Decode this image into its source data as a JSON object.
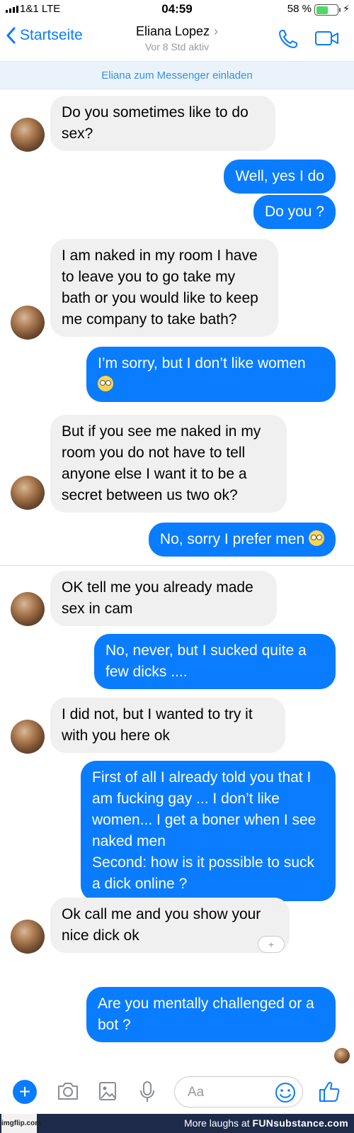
{
  "status_bar": {
    "carrier": "1&1  LTE",
    "time": "04:59",
    "battery": "58 %",
    "battery_level": 0.58,
    "charging_icon": "bolt-icon"
  },
  "header": {
    "back_label": "Startseite",
    "contact_name": "Eliana Lopez",
    "contact_status": "Vor 8 Std aktiv",
    "icons": [
      "chevron-left-icon",
      "phone-icon",
      "video-icon"
    ],
    "accent": "#0a7cff"
  },
  "invite_banner": "Eliana zum Messenger einladen",
  "messages": [
    {
      "from": "them",
      "text": "Do you sometimes like to do sex?"
    },
    {
      "from": "me",
      "text": "Well, yes I do"
    },
    {
      "from": "me",
      "text": "Do you ?"
    },
    {
      "from": "them",
      "text": "I am naked in my room I have to leave you to go take my bath or you would like to keep me company to take bath?"
    },
    {
      "from": "me",
      "text": "I’m sorry, but I don’t like women",
      "emoji": "eye-roll-emoji"
    },
    {
      "from": "them",
      "text": "But if you see me naked in my room you do not have to tell anyone else I want it to be a secret between us two ok?"
    },
    {
      "from": "me",
      "text": "No, sorry I prefer men",
      "emoji": "eye-roll-emoji"
    },
    {
      "from": "them",
      "text": "OK tell me you already made sex in cam"
    },
    {
      "from": "me",
      "text": "No, never, but I sucked quite a few dicks ...."
    },
    {
      "from": "them",
      "text": "I did not, but I wanted to try it with you here ok"
    },
    {
      "from": "me",
      "text": "First of all I already told you that I am fucking gay ... I don’t like women... I get a boner when I see naked men\nSecond: how is it possible to suck a dick online ?"
    },
    {
      "from": "them",
      "text": "Ok call me and you show your nice dick ok"
    },
    {
      "from": "me",
      "text": "Are you mentally challenged or a bot ?"
    }
  ],
  "reaction_button": "+",
  "composer": {
    "placeholder": "Aa",
    "icons": [
      "plus-icon",
      "camera-icon",
      "image-icon",
      "microphone-icon",
      "smiley-icon",
      "thumbs-up-icon"
    ]
  },
  "footer": {
    "watermark": "imgflip.com",
    "text": "More laughs at ",
    "brand": "FUNsubstance.com"
  },
  "colors": {
    "incoming_bubble": "#f1f0f0",
    "outgoing_bubble": "#0a7cff",
    "banner": "#eaf3fc",
    "footer": "#1d2a4a"
  }
}
